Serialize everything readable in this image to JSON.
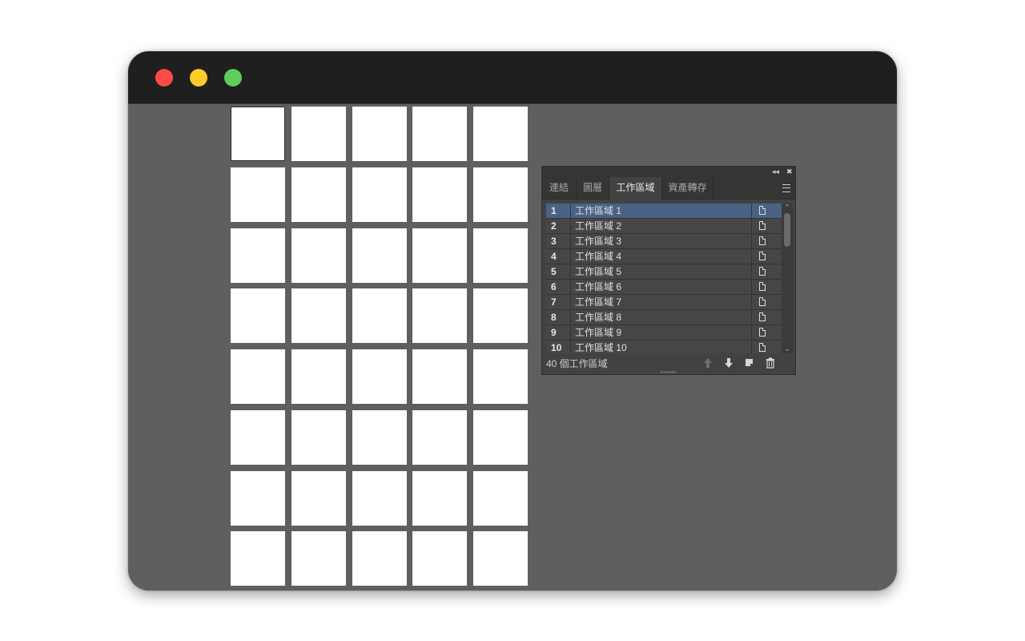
{
  "window": {
    "controls": [
      "close",
      "minimize",
      "zoom"
    ]
  },
  "canvas": {
    "artboard_count": 40,
    "columns": 5,
    "selected_index": 0
  },
  "panel": {
    "collapse_icon": "double-chevron-left-icon",
    "close_icon": "close-icon",
    "tabs": [
      {
        "label": "連結",
        "active": false
      },
      {
        "label": "圖層",
        "active": false
      },
      {
        "label": "工作區域",
        "active": true
      },
      {
        "label": "資產轉存",
        "active": false
      }
    ],
    "rows": [
      {
        "num": "1",
        "name": "工作區域 1",
        "selected": true
      },
      {
        "num": "2",
        "name": "工作區域 2",
        "selected": false
      },
      {
        "num": "3",
        "name": "工作區域 3",
        "selected": false
      },
      {
        "num": "4",
        "name": "工作區域 4",
        "selected": false
      },
      {
        "num": "5",
        "name": "工作區域 5",
        "selected": false
      },
      {
        "num": "6",
        "name": "工作區域 6",
        "selected": false
      },
      {
        "num": "7",
        "name": "工作區域 7",
        "selected": false
      },
      {
        "num": "8",
        "name": "工作區域 8",
        "selected": false
      },
      {
        "num": "9",
        "name": "工作區域 9",
        "selected": false
      },
      {
        "num": "10",
        "name": "工作區域 10",
        "selected": false
      }
    ],
    "footer": {
      "count_label": "40 個工作區域",
      "buttons": [
        "move-up-icon",
        "move-down-icon",
        "new-artboard-icon",
        "trash-icon"
      ]
    },
    "colors": {
      "selected_row": "#4a6284",
      "panel_bg": "#424242"
    }
  }
}
